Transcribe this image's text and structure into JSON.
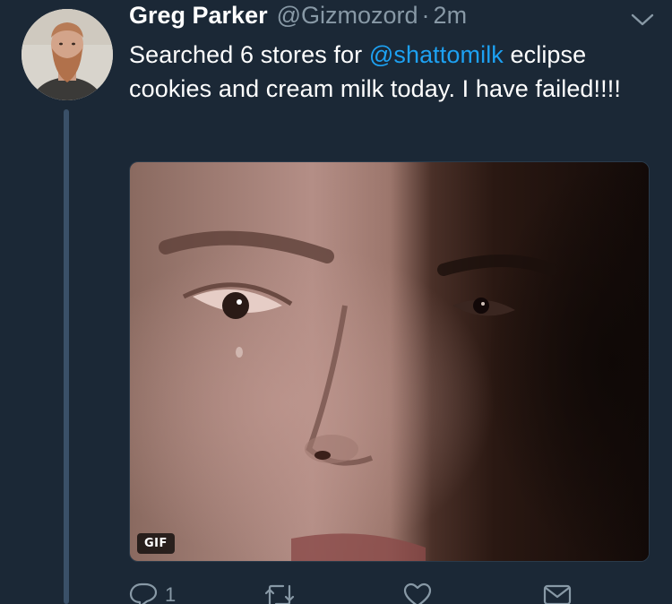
{
  "author": {
    "name": "Greg Parker",
    "handle": "@Gizmozord",
    "separator": "·",
    "time": "2m"
  },
  "tweet": {
    "text_before": "Searched 6 stores for ",
    "mention": "@shattomilk",
    "text_after": " eclipse cookies and cream milk today. I have failed!!!!"
  },
  "media": {
    "badge": "GIF"
  },
  "actions": {
    "reply_count": "1",
    "retweet_count": "",
    "like_count": ""
  },
  "colors": {
    "background": "#1b2836",
    "text": "#ffffff",
    "muted": "#8899a6",
    "link": "#1da1f2",
    "thread_line": "#3a5068"
  },
  "icons": [
    "chevron-down-icon",
    "reply-icon",
    "retweet-icon",
    "like-icon",
    "direct-message-icon"
  ]
}
